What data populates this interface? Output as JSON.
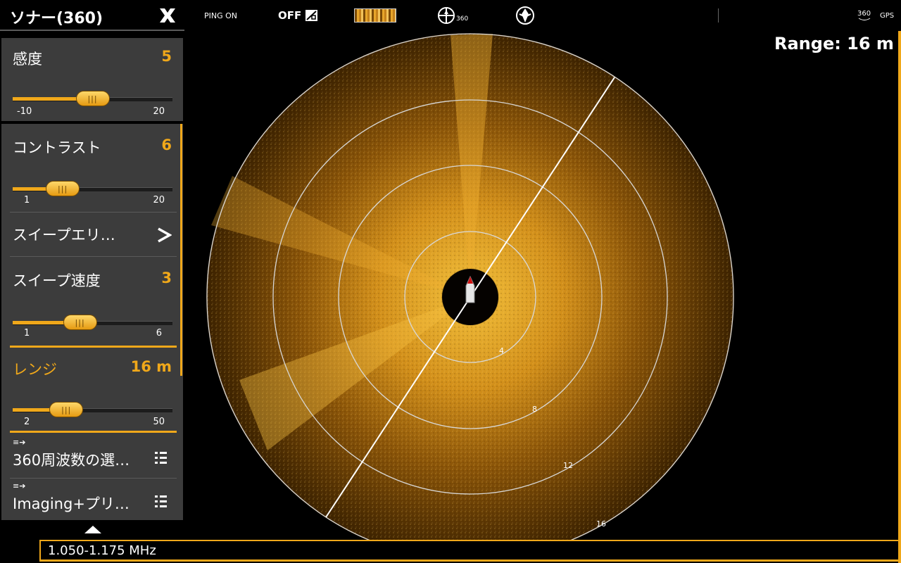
{
  "panel": {
    "title": "ソナー(360)",
    "sensitivity": {
      "label": "感度",
      "value": "5",
      "min": "-10",
      "max": "20",
      "level": 5,
      "lo": -10,
      "hi": 20
    },
    "contrast": {
      "label": "コントラスト",
      "value": "6",
      "min": "1",
      "max": "20",
      "level": 6,
      "lo": 1,
      "hi": 20
    },
    "sweep_area": {
      "label": "スイープエリ…"
    },
    "sweep_speed": {
      "label": "スイープ速度",
      "value": "3",
      "min": "1",
      "max": "6",
      "level": 3,
      "lo": 1,
      "hi": 6
    },
    "range": {
      "label": "レンジ",
      "value": "16 m",
      "min": "2",
      "max": "50",
      "level": 16,
      "lo": 2,
      "hi": 50
    },
    "frequency": {
      "label": "360周波数の選…"
    },
    "imaging": {
      "label": "Imaging+プリ…"
    }
  },
  "topbar": {
    "ping": "PING ON",
    "off": "OFF",
    "mode_360": "360",
    "right_360": "360",
    "gps": "GPS"
  },
  "display": {
    "range_text": "Range: 16 m",
    "frequency_text": "1.050-1.175 MHz",
    "rings": [
      "4",
      "8",
      "12",
      "16"
    ]
  },
  "colors": {
    "accent": "#f0a81a",
    "panel_bg": "#3c3c3c"
  }
}
